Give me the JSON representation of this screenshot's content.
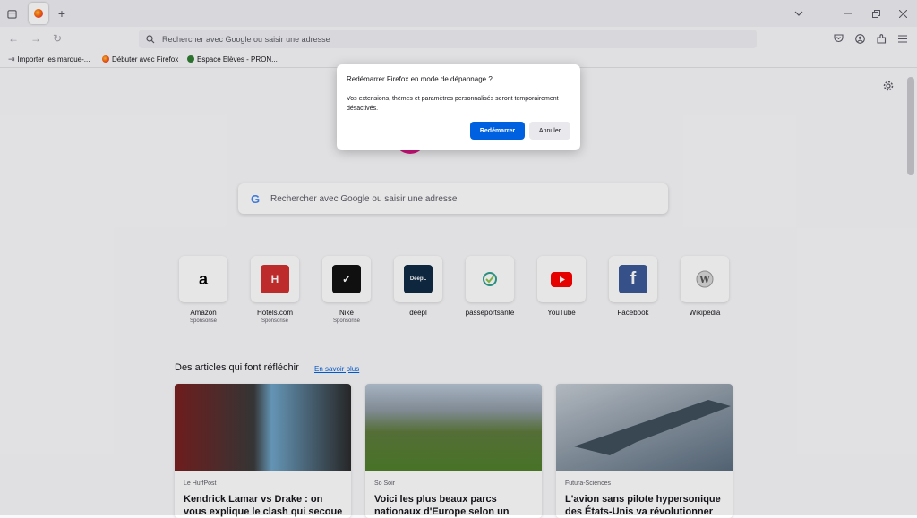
{
  "toolbar": {
    "url_placeholder": "Rechercher avec Google ou saisir une adresse"
  },
  "bookmarks": [
    {
      "label": "Importer les marque-..."
    },
    {
      "label": "Débuter avec Firefox"
    },
    {
      "label": "Espace Elèves - PRON..."
    }
  ],
  "newtab": {
    "search_placeholder": "Rechercher avec Google ou saisir une adresse",
    "shortcuts": [
      {
        "label": "Amazon",
        "sub": "Sponsorisé",
        "icon": "amazon-icon"
      },
      {
        "label": "Hotels.com",
        "sub": "Sponsorisé",
        "icon": "hotels-icon"
      },
      {
        "label": "Nike",
        "sub": "Sponsorisé",
        "icon": "nike-icon"
      },
      {
        "label": "deepl",
        "sub": "",
        "icon": "deepl-icon"
      },
      {
        "label": "passeportsante",
        "sub": "",
        "icon": "passeportsante-icon"
      },
      {
        "label": "YouTube",
        "sub": "",
        "icon": "youtube-icon"
      },
      {
        "label": "Facebook",
        "sub": "",
        "icon": "facebook-icon"
      },
      {
        "label": "Wikipedia",
        "sub": "",
        "icon": "wikipedia-icon"
      }
    ],
    "stories_title": "Des articles qui font réfléchir",
    "learn_more": "En savoir plus",
    "cards": [
      {
        "source": "Le HuffPost",
        "title": "Kendrick Lamar vs Drake : on vous explique le clash qui secoue le rap"
      },
      {
        "source": "So Soir",
        "title": "Voici les plus beaux parcs nationaux d'Europe selon un"
      },
      {
        "source": "Futura-Sciences",
        "title": "L'avion sans pilote hypersonique des États-Unis va révolutionner"
      }
    ]
  },
  "dialog": {
    "title": "Redémarrer Firefox en mode de dépannage ?",
    "message": "Vos extensions, thèmes et paramètres personnalisés seront temporairement désactivés.",
    "confirm": "Redémarrer",
    "cancel": "Annuler"
  },
  "colors": {
    "accent": "#0061e0"
  }
}
